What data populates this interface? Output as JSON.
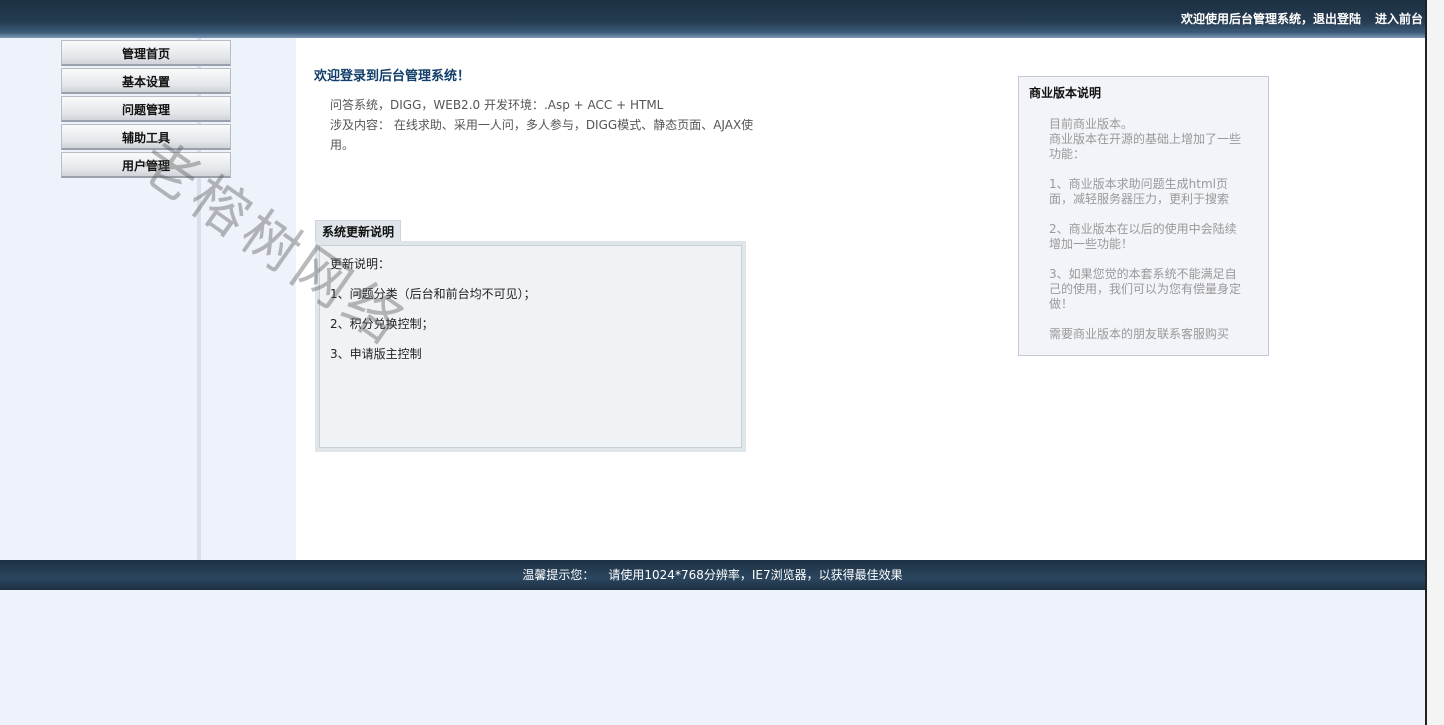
{
  "header": {
    "welcome": "欢迎使用后台管理系统，",
    "logout": "退出登陆",
    "enter_front": "进入前台"
  },
  "sidebar": {
    "items": [
      {
        "label": "管理首页"
      },
      {
        "label": "基本设置"
      },
      {
        "label": "问题管理"
      },
      {
        "label": "辅助工具"
      },
      {
        "label": "用户管理"
      }
    ]
  },
  "main": {
    "title": "欢迎登录到后台管理系统！",
    "intro_line1": "问答系统，DIGG，WEB2.0 开发环境：.Asp + ACC + HTML",
    "intro_line2": "涉及内容： 在线求助、采用一人问，多人参与，DIGG模式、静态页面、AJAX使用。",
    "update_tab": "系统更新说明",
    "update_items": [
      "更新说明：",
      "1、问题分类（后台和前台均不可见）；",
      "2、积分兑换控制；",
      "3、申请版主控制"
    ]
  },
  "commercial": {
    "title": "商业版本说明",
    "paragraphs": [
      "目前商业版本。\n商业版本在开源的基础上增加了一些功能：",
      "1、商业版本求助问题生成html页面，减轻服务器压力，更利于搜索",
      "2、商业版本在以后的使用中会陆续增加一些功能！",
      "3、如果您觉的本套系统不能满足自己的使用，我们可以为您有偿量身定做！",
      "需要商业版本的朋友联系客服购买"
    ]
  },
  "watermark": "老榕树网络",
  "footer": {
    "label": "温馨提示您：",
    "text": "请使用1024*768分辨率，IE7浏览器，以获得最佳效果"
  }
}
